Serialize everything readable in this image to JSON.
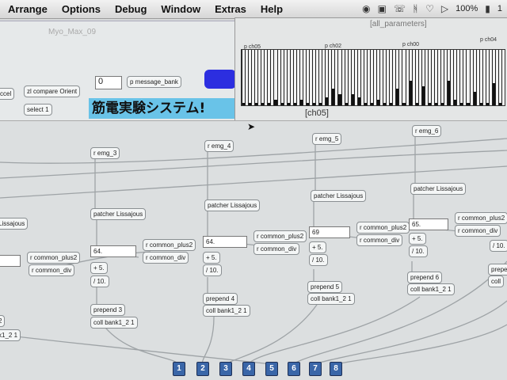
{
  "menubar": {
    "items": [
      "Arrange",
      "Options",
      "Debug",
      "Window",
      "Extras",
      "Help"
    ],
    "battery": "100%",
    "clock": "1"
  },
  "main_window": {
    "title": "Myo_Max_09"
  },
  "param_window": {
    "title": "[all_parameters]",
    "section_labels": [
      "p ch05",
      "p ch02",
      "p ch00",
      "p ch04"
    ],
    "slider_levels": [
      0.05,
      0.05,
      0.05,
      0.05,
      0.05,
      0.1,
      0.05,
      0.05,
      0.05,
      0.1,
      0.05,
      0.05,
      0.05,
      0.15,
      0.3,
      0.2,
      0.05,
      0.2,
      0.15,
      0.05,
      0.05,
      0.1,
      0.05,
      0.05,
      0.3,
      0.05,
      0.45,
      0.05,
      0.35,
      0.05,
      0.05,
      0.05,
      0.45,
      0.1,
      0.05,
      0.05,
      0.25,
      0.05,
      0.05,
      0.4,
      0.05
    ]
  },
  "grid_window": {
    "title": "[ch05]"
  },
  "top_objects": {
    "accel": "ccel",
    "compare": "zl compare Orient",
    "select": "select 1",
    "number": "0",
    "message_bank": "p message_bank",
    "banner": "筋電実験システム!"
  },
  "columns": [
    {
      "emg": "r emg_3",
      "patcher": "patcher Lissajous",
      "num": "64.",
      "plus": "+ 5.",
      "div": "/ 10.",
      "prepend": "prepend 3",
      "coll": "coll bank1_2 1"
    },
    {
      "emg": "r emg_4",
      "patcher": "patcher Lissajous",
      "num": "64.",
      "plus": "+ 5.",
      "div": "/ 10.",
      "prepend": "prepend 4",
      "coll": "coll bank1_2 1"
    },
    {
      "emg": "r emg_5",
      "patcher": "patcher Lissajous",
      "num": "69",
      "plus": "+ 5.",
      "div": "/ 10.",
      "prepend": "prepend 5",
      "coll": "coll bank1_2 1"
    },
    {
      "emg": "r emg_6",
      "patcher": "patcher Lissajous",
      "num": "65.",
      "plus": "+ 5.",
      "div": "/ 10.",
      "prepend": "prepend 6",
      "coll": "coll bank1_2 1"
    }
  ],
  "common": {
    "plus": "r common_plus2",
    "div": "r common_div"
  },
  "left_edge": {
    "lissajous": "Lissajous",
    "plus": "r common_plus2",
    "div": "r common_div",
    "prepend": "2",
    "coll": "k1_2 1"
  },
  "right_edge": {
    "div": "/ 10.",
    "prepend": "prepe",
    "coll": "coll"
  },
  "outlets": [
    "1",
    "2",
    "3",
    "4",
    "5",
    "6",
    "7",
    "8"
  ]
}
